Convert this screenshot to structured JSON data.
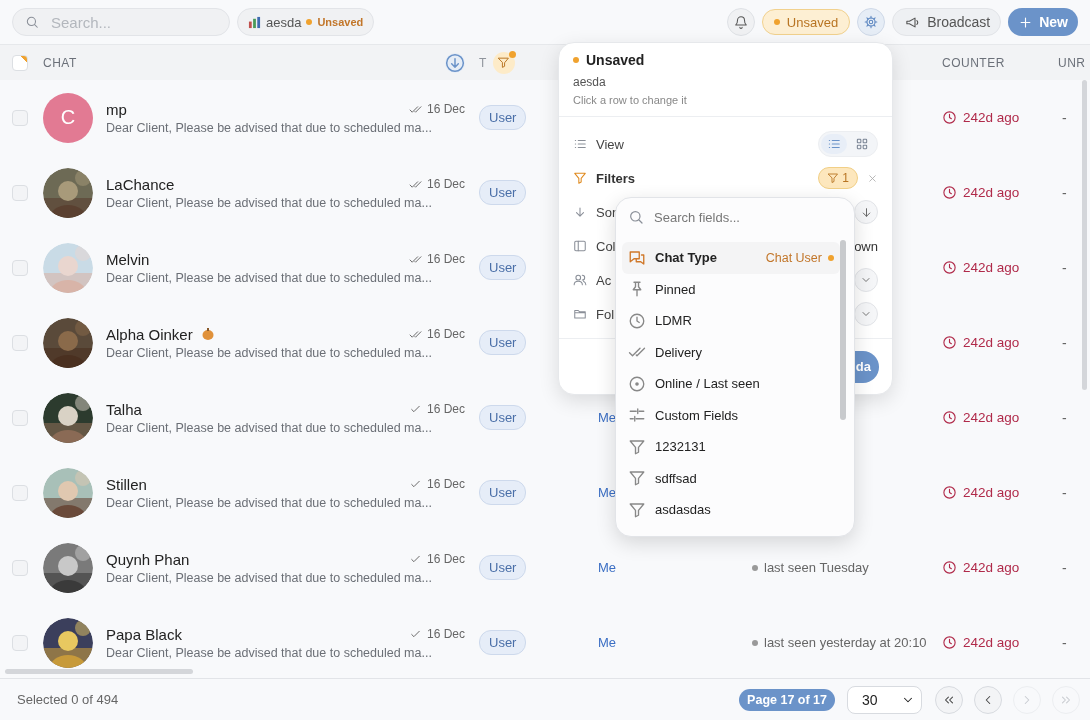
{
  "toolbar": {
    "search_placeholder": "Search...",
    "view": {
      "name": "aesda",
      "status": "Unsaved"
    },
    "state_pill": "Unsaved",
    "broadcast": "Broadcast",
    "new": "New"
  },
  "table": {
    "header": {
      "checked": false,
      "partial": true,
      "chat": "CHAT",
      "sorted": true,
      "column_2": "T",
      "filtered": true,
      "counter": "COUNTER",
      "unread": "UNR"
    },
    "rows": [
      {
        "checked": false,
        "avatar": {
          "kind": "initial",
          "initial": "C",
          "color": "#e27a93"
        },
        "name": "mp",
        "read": true,
        "date": "16 Dec",
        "preview": "Dear Client, Please be advised that due to scheduled ma...",
        "type": "User",
        "counter": "242d ago",
        "unread": "-"
      },
      {
        "checked": false,
        "name": "LaChance",
        "read": true,
        "date": "16 Dec",
        "preview": "Dear Client, Please be advised that due to scheduled ma...",
        "type": "User",
        "counter": "242d ago",
        "unread": "-"
      },
      {
        "checked": false,
        "name": "Melvin",
        "read": true,
        "date": "16 Dec",
        "preview": "Dear Client, Please be advised that due to scheduled ma...",
        "type": "User",
        "counter": "242d ago",
        "unread": "-"
      },
      {
        "checked": false,
        "name": "Alpha Oinker",
        "name_icon": true,
        "read": true,
        "date": "16 Dec",
        "preview": "Dear Client, Please be advised that due to scheduled ma...",
        "type": "User",
        "counter": "242d ago",
        "unread": "-"
      },
      {
        "checked": false,
        "name": "Talha",
        "read": false,
        "date": "16 Dec",
        "preview": "Dear Client, Please be advised that due to scheduled ma...",
        "type": "User",
        "owner": "Me",
        "counter": "242d ago",
        "unread": "-"
      },
      {
        "checked": false,
        "name": "Stillen",
        "read": false,
        "date": "16 Dec",
        "preview": "Dear Client, Please be advised that due to scheduled ma...",
        "type": "User",
        "owner": "Me",
        "counter": "242d ago",
        "unread": "-"
      },
      {
        "checked": false,
        "name": "Quynh Phan",
        "read": false,
        "date": "16 Dec",
        "preview": "Dear Client, Please be advised that due to scheduled ma...",
        "type": "User",
        "owner": "Me",
        "status": "last seen Tuesday",
        "counter": "242d ago",
        "unread": "-"
      },
      {
        "checked": false,
        "name": "Papa Black",
        "read": false,
        "date": "16 Dec",
        "preview": "Dear Client, Please be advised that due to scheduled ma...",
        "type": "User",
        "owner": "Me",
        "status": "last seen yesterday at 20:10",
        "counter": "242d ago",
        "unread": "-"
      }
    ]
  },
  "popover": {
    "status": "Unsaved",
    "view_name": "aesda",
    "hint": "Click a row to change it",
    "rows": [
      {
        "kind": "view",
        "label": "View",
        "options": [
          {
            "kind": "list",
            "selected": true
          },
          {
            "kind": "grid",
            "selected": false
          }
        ]
      },
      {
        "kind": "filters",
        "label": "Filters",
        "count": "1",
        "active": true
      },
      {
        "kind": "sort",
        "label": "Sor"
      },
      {
        "kind": "columns",
        "label": "Col",
        "value": "own"
      },
      {
        "kind": "access",
        "label": "Ac"
      },
      {
        "kind": "folder",
        "label": "Fol"
      }
    ],
    "save_button": "da"
  },
  "field_menu": {
    "placeholder": "Search fields...",
    "items": [
      {
        "kind": "chat",
        "label": "Chat Type",
        "value": "Chat User",
        "selected": true
      },
      {
        "kind": "pin",
        "label": "Pinned",
        "selected": false
      },
      {
        "kind": "clock",
        "label": "LDMR",
        "selected": false
      },
      {
        "kind": "checks",
        "label": "Delivery",
        "selected": false
      },
      {
        "kind": "dot",
        "label": "Online / Last seen",
        "selected": false
      },
      {
        "kind": "sliders",
        "label": "Custom Fields",
        "selected": false
      },
      {
        "kind": "filter",
        "label": "1232131",
        "selected": false
      },
      {
        "kind": "filter",
        "label": "sdffsad",
        "selected": false
      },
      {
        "kind": "filter",
        "label": "asdasdas",
        "selected": false
      }
    ]
  },
  "footer": {
    "selection": "Selected 0 of 494",
    "page": "Page 17 of 17",
    "page_size": "30",
    "nav": [
      {
        "kind": "first",
        "disabled": false
      },
      {
        "kind": "prev",
        "disabled": false
      },
      {
        "kind": "next",
        "disabled": true
      },
      {
        "kind": "last",
        "disabled": true
      }
    ]
  }
}
